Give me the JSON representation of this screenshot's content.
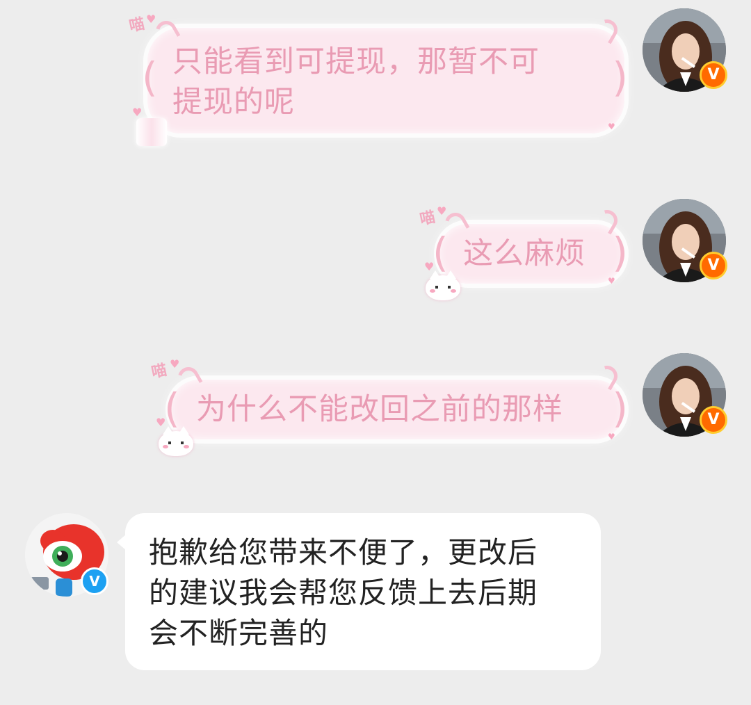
{
  "conversation": {
    "messages": [
      {
        "sender": "user",
        "text": "只能看到可提现，那暂不可\n提现的呢"
      },
      {
        "sender": "user",
        "text": "这么麻烦"
      },
      {
        "sender": "user",
        "text": "为什么不能改回之前的那样"
      },
      {
        "sender": "support",
        "text": "抱歉给您带来不便了，更改后\n的建议我会帮您反馈上去后期\n会不断完善的"
      }
    ]
  },
  "decor": {
    "meow_text": "喵",
    "verified_badge": "V",
    "bubble_style": "pink cat-ear bubble",
    "colors": {
      "background": "#ededed",
      "pink_bubble": "#fce8ef",
      "pink_text": "#e99bb3",
      "white_bubble": "#ffffff",
      "reply_text": "#222222",
      "user_badge": "#ff6a00",
      "support_badge": "#1da1f2"
    }
  },
  "icons": {
    "user_avatar": "user-avatar-photo",
    "support_avatar": "weibo-mascot-avatar",
    "user_verified": "orange-verified-v-icon",
    "support_verified": "blue-verified-v-icon"
  }
}
